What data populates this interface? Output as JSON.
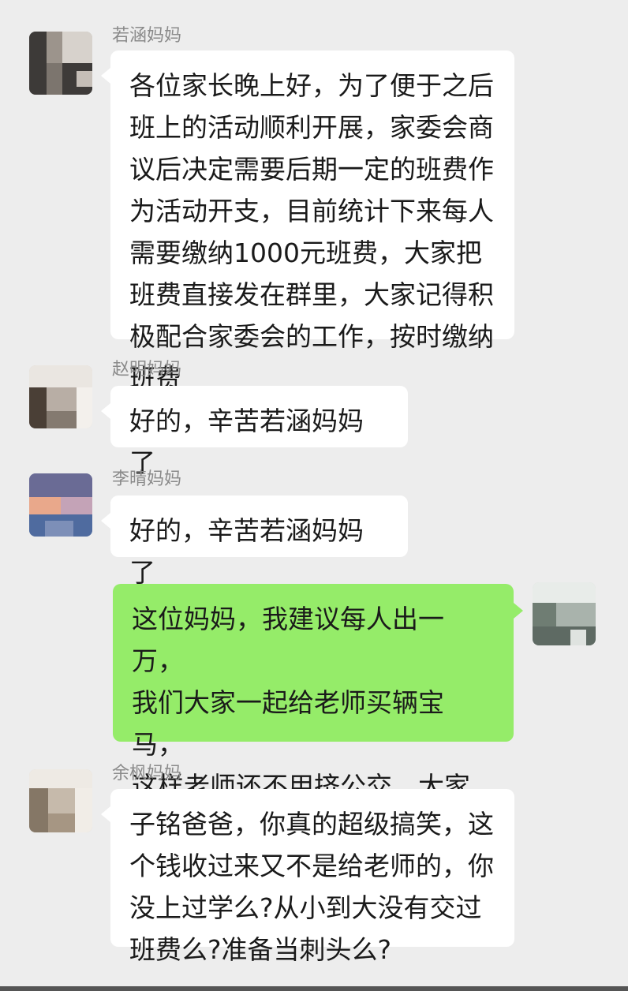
{
  "messages": [
    {
      "sender": "若涵妈妈",
      "text": "各位家长晚上好，为了便于之后\n班上的活动顺利开展，家委会商\n议后决定需要后期一定的班费作\n为活动开支，目前统计下来每人\n需要缴纳1000元班费，大家把\n班费直接发在群里，大家记得积\n极配合家委会的工作，按时缴纳\n班费"
    },
    {
      "sender": "赵明妈妈",
      "text": "好的，辛苦若涵妈妈了"
    },
    {
      "sender": "李晴妈妈",
      "text": "好的，辛苦若涵妈妈了"
    },
    {
      "sender": "",
      "outgoing": true,
      "text": "这位妈妈，我建议每人出一万，\n我们大家一起给老师买辆宝马，\n这样老师还不用挤公交，大家意\n下如何"
    },
    {
      "sender": "余枫妈妈",
      "text": "子铭爸爸，你真的超级搞笑，这\n个钱收过来又不是给老师的，你\n没上过学么?从小到大没有交过\n班费么?准备当刺头么?"
    }
  ],
  "colors": {
    "background": "#ededed",
    "incoming_bubble": "#ffffff",
    "outgoing_bubble": "#95ec69",
    "sender_name": "#8a8a8a"
  }
}
